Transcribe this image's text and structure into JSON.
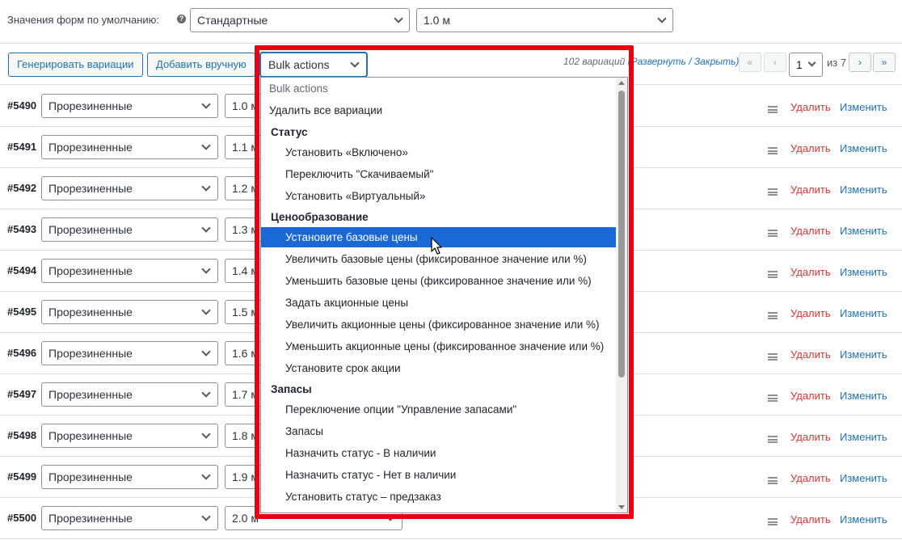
{
  "defaults": {
    "label": "Значения форм по умолчанию:",
    "help_icon": "?",
    "select_1": "Стандартные",
    "select_2": "1.0 м"
  },
  "toolbar": {
    "generate_label": "Генерировать вариации",
    "add_manual_label": "Добавить вручную",
    "bulk_actions_value": "Bulk actions",
    "count_text": "102 вариаций",
    "expand_close_text": "(Развернуть / Закрыть)",
    "page_first": "«",
    "page_prev": "‹",
    "page_current": "1",
    "page_total": "из 7",
    "page_next": "›",
    "page_last": "»"
  },
  "variations": [
    {
      "id": "#5490",
      "type": "Прорезиненные",
      "length": "1.0 м"
    },
    {
      "id": "#5491",
      "type": "Прорезиненные",
      "length": "1.1 м"
    },
    {
      "id": "#5492",
      "type": "Прорезиненные",
      "length": "1.2 м"
    },
    {
      "id": "#5493",
      "type": "Прорезиненные",
      "length": "1.3 м"
    },
    {
      "id": "#5494",
      "type": "Прорезиненные",
      "length": "1.4 м"
    },
    {
      "id": "#5495",
      "type": "Прорезиненные",
      "length": "1.5 м"
    },
    {
      "id": "#5496",
      "type": "Прорезиненные",
      "length": "1.6 м"
    },
    {
      "id": "#5497",
      "type": "Прорезиненные",
      "length": "1.7 м"
    },
    {
      "id": "#5498",
      "type": "Прорезиненные",
      "length": "1.8 м"
    },
    {
      "id": "#5499",
      "type": "Прорезиненные",
      "length": "1.9 м"
    },
    {
      "id": "#5500",
      "type": "Прорезиненные",
      "length": "2.0 м"
    }
  ],
  "row_actions": {
    "delete_label": "Удалить",
    "edit_label": "Изменить"
  },
  "dropdown": {
    "items": [
      {
        "label": "Bulk actions",
        "kind": "placeholder"
      },
      {
        "label": "Удалить все вариации",
        "kind": "top"
      },
      {
        "label": "Статус",
        "kind": "group"
      },
      {
        "label": "Установить «Включено»",
        "kind": "option"
      },
      {
        "label": "Переключить \"Скачиваемый\"",
        "kind": "option"
      },
      {
        "label": "Установить «Виртуальный»",
        "kind": "option"
      },
      {
        "label": "Ценообразование",
        "kind": "group"
      },
      {
        "label": "Установите базовые цены",
        "kind": "selected"
      },
      {
        "label": "Увеличить базовые цены (фиксированное значение или %)",
        "kind": "option"
      },
      {
        "label": "Уменьшить базовые цены (фиксированное значение или %)",
        "kind": "option"
      },
      {
        "label": "Задать акционные цены",
        "kind": "option"
      },
      {
        "label": "Увеличить акционные цены (фиксированное значение или %)",
        "kind": "option"
      },
      {
        "label": "Уменьшить акционные цены (фиксированное значение или %)",
        "kind": "option"
      },
      {
        "label": "Установите срок акции",
        "kind": "option"
      },
      {
        "label": "Запасы",
        "kind": "group"
      },
      {
        "label": "Переключение опции \"Управление запасами\"",
        "kind": "option"
      },
      {
        "label": "Запасы",
        "kind": "option"
      },
      {
        "label": "Назначить статус - В наличии",
        "kind": "option"
      },
      {
        "label": "Назначить статус - Нет в наличии",
        "kind": "option"
      },
      {
        "label": "Установить статус – предзаказ",
        "kind": "option"
      }
    ]
  },
  "colors": {
    "accent": "#2271b1",
    "delete": "#d63638",
    "highlight": "#e60012",
    "selected_option": "#1a68d6"
  }
}
